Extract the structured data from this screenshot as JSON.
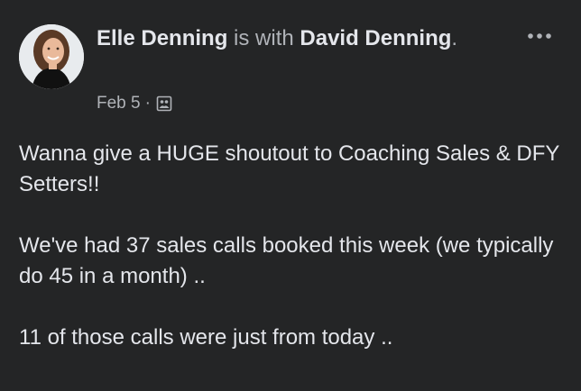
{
  "post": {
    "author": "Elle Denning",
    "with_text": "is with",
    "tagged": "David Denning",
    "period": ".",
    "date": "Feb 5",
    "separator": "·",
    "audience_icon": "tagged-photo-icon",
    "more_icon": "more-options-icon",
    "paragraphs": [
      "Wanna give a HUGE shoutout to Coaching Sales & DFY Setters!!",
      "We've had 37 sales calls booked this week (we typically do 45 in a month) ..",
      "11 of those calls were just from today .."
    ]
  },
  "colors": {
    "background": "#242526",
    "text_primary": "#e4e6eb",
    "text_secondary": "#b0b3b8"
  }
}
